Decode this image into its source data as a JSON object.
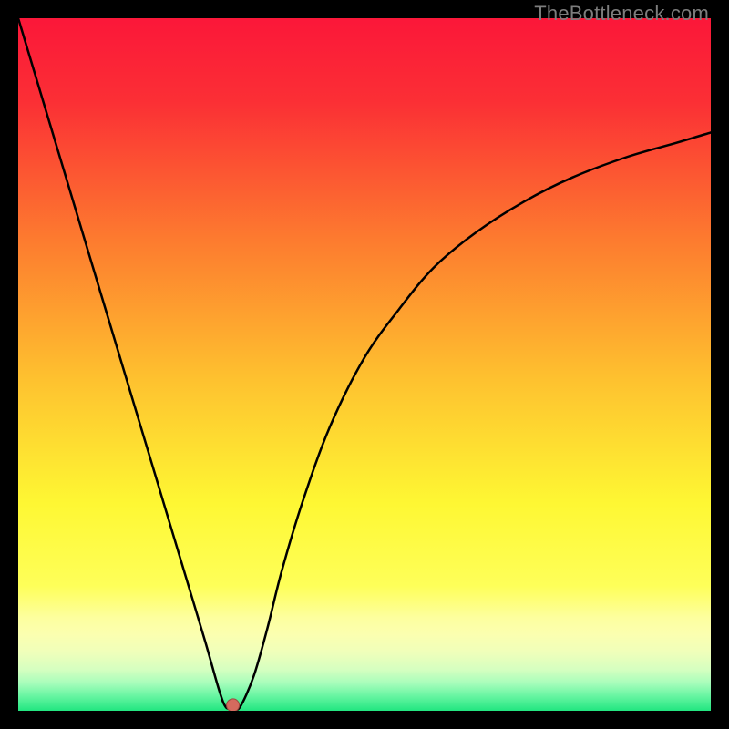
{
  "watermark": "TheBottleneck.com",
  "colors": {
    "bg_black": "#000000",
    "curve": "#000000",
    "marker_fill": "#d46a5e",
    "marker_stroke": "#9c4a40",
    "grad_top": "#fb1739",
    "grad_mid1": "#fd7b2f",
    "grad_mid2": "#fef733",
    "grad_band1": "#fdffa8",
    "grad_band2": "#f3ffb8",
    "grad_band3": "#d4ffc0",
    "grad_band4": "#93fcb2",
    "grad_bottom": "#22e680"
  },
  "chart_data": {
    "type": "line",
    "title": "",
    "xlabel": "",
    "ylabel": "",
    "xlim": [
      0,
      100
    ],
    "ylim": [
      0,
      100
    ],
    "series": [
      {
        "name": "bottleneck-curve",
        "x": [
          0,
          3,
          6,
          9,
          12,
          15,
          18,
          21,
          24,
          27,
          29,
          30,
          31,
          32,
          34,
          36,
          38,
          41,
          45,
          50,
          55,
          60,
          66,
          73,
          80,
          88,
          95,
          100
        ],
        "y": [
          100,
          90,
          80,
          70,
          60,
          50,
          40,
          30,
          20,
          10,
          3,
          0.5,
          0.5,
          0.5,
          5,
          12,
          20,
          30,
          41,
          51,
          58,
          64,
          69,
          73.5,
          77,
          80,
          82,
          83.5
        ]
      }
    ],
    "marker": {
      "x": 31,
      "y": 0.8
    },
    "annotations": [],
    "legend": false,
    "grid": false
  }
}
